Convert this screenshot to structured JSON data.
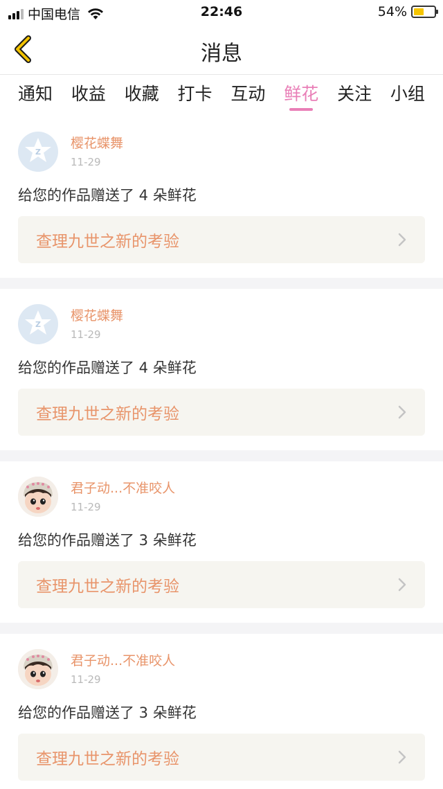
{
  "status_bar": {
    "carrier": "中国电信",
    "time": "22:46",
    "battery_percent": "54%",
    "battery_level": 0.54
  },
  "nav": {
    "title": "消息",
    "back_icon": "chevron-left-icon",
    "accent_color": "#f2c200"
  },
  "tabs": [
    {
      "label": "通知",
      "active": false
    },
    {
      "label": "收益",
      "active": false
    },
    {
      "label": "收藏",
      "active": false
    },
    {
      "label": "打卡",
      "active": false
    },
    {
      "label": "互动",
      "active": false
    },
    {
      "label": "鲜花",
      "active": true
    },
    {
      "label": "关注",
      "active": false
    },
    {
      "label": "小组",
      "active": false
    }
  ],
  "colors": {
    "active_tab": "#e97fb7",
    "username": "#e8946a",
    "work_title": "#e8946a"
  },
  "messages": [
    {
      "user": "樱花蝶舞",
      "date": "11-29",
      "text": "给您的作品赠送了 4 朵鲜花",
      "work": "查理九世之新的考验",
      "avatar": "qq-default-avatar"
    },
    {
      "user": "樱花蝶舞",
      "date": "11-29",
      "text": "给您的作品赠送了 4 朵鲜花",
      "work": "查理九世之新的考验",
      "avatar": "qq-default-avatar"
    },
    {
      "user": "君子动...不准咬人",
      "date": "11-29",
      "text": "给您的作品赠送了 3 朵鲜花",
      "work": "查理九世之新的考验",
      "avatar": "doll-avatar"
    },
    {
      "user": "君子动...不准咬人",
      "date": "11-29",
      "text": "给您的作品赠送了 3 朵鲜花",
      "work": "查理九世之新的考验",
      "avatar": "doll-avatar"
    }
  ]
}
